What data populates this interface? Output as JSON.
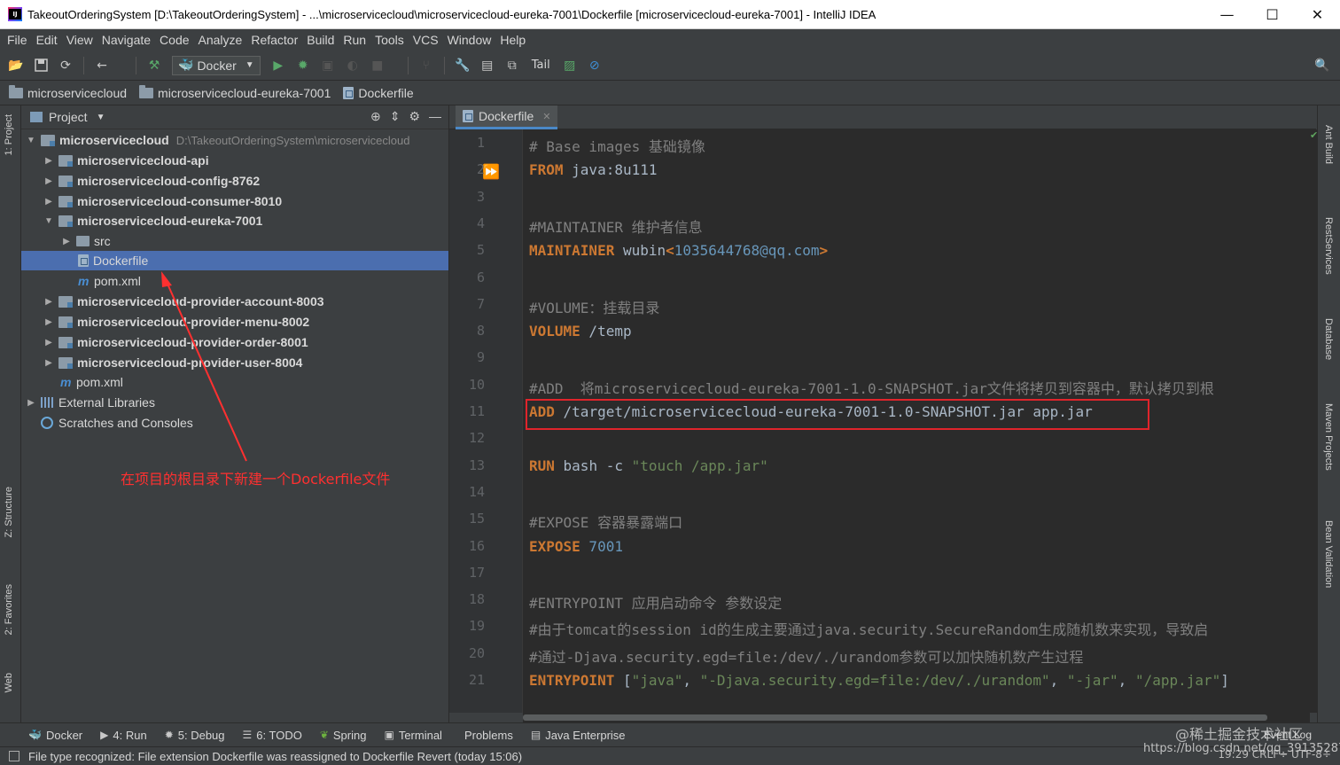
{
  "window": {
    "title": "TakeoutOrderingSystem [D:\\TakeoutOrderingSystem] - ...\\microservicecloud\\microservicecloud-eureka-7001\\Dockerfile [microservicecloud-eureka-7001] - IntelliJ IDEA",
    "minimize": "—",
    "maximize": "☐",
    "close": "✕"
  },
  "menu": [
    "File",
    "Edit",
    "View",
    "Navigate",
    "Code",
    "Analyze",
    "Refactor",
    "Build",
    "Run",
    "Tools",
    "VCS",
    "Window",
    "Help"
  ],
  "toolbar": {
    "run_config": "Docker",
    "tail": "Tail"
  },
  "breadcrumb": [
    "microservicecloud",
    "microservicecloud-eureka-7001",
    "Dockerfile"
  ],
  "left_tabs": {
    "project": "1: Project",
    "structure": "Z: Structure",
    "favorites": "2: Favorites",
    "web": "Web"
  },
  "project": {
    "header": "Project",
    "tree": [
      {
        "label": "microservicecloud",
        "hint": "D:\\TakeoutOrderingSystem\\microservicecloud"
      },
      {
        "label": "microservicecloud-api"
      },
      {
        "label": "microservicecloud-config-8762"
      },
      {
        "label": "microservicecloud-consumer-8010"
      },
      {
        "label": "microservicecloud-eureka-7001"
      },
      {
        "label": "src"
      },
      {
        "label": "Dockerfile"
      },
      {
        "label": "pom.xml"
      },
      {
        "label": "microservicecloud-provider-account-8003"
      },
      {
        "label": "microservicecloud-provider-menu-8002"
      },
      {
        "label": "microservicecloud-provider-order-8001"
      },
      {
        "label": "microservicecloud-provider-user-8004"
      },
      {
        "label": "pom.xml"
      },
      {
        "label": "External Libraries"
      },
      {
        "label": "Scratches and Consoles"
      }
    ]
  },
  "editor": {
    "tab": "Dockerfile",
    "lines": [
      {
        "n": "1",
        "parts": [
          [
            "cmt",
            "# Base images 基础镜像"
          ]
        ]
      },
      {
        "n": "2",
        "parts": [
          [
            "kw",
            "FROM"
          ],
          [
            "txt",
            " java:8u111"
          ]
        ]
      },
      {
        "n": "3",
        "parts": []
      },
      {
        "n": "4",
        "parts": [
          [
            "cmt",
            "#MAINTAINER 维护者信息"
          ]
        ]
      },
      {
        "n": "5",
        "parts": [
          [
            "kw",
            "MAINTAINER"
          ],
          [
            "txt",
            " wubin"
          ],
          [
            "kw",
            "<"
          ],
          [
            "lnk",
            "1035644768@qq.com"
          ],
          [
            "kw",
            ">"
          ]
        ]
      },
      {
        "n": "6",
        "parts": []
      },
      {
        "n": "7",
        "parts": [
          [
            "cmt",
            "#VOLUME：挂载目录"
          ]
        ]
      },
      {
        "n": "8",
        "parts": [
          [
            "kw",
            "VOLUME"
          ],
          [
            "txt",
            " /temp"
          ]
        ]
      },
      {
        "n": "9",
        "parts": []
      },
      {
        "n": "10",
        "parts": [
          [
            "cmt",
            "#ADD  将microservicecloud-eureka-7001-1.0-SNAPSHOT.jar文件将拷贝到容器中，默认拷贝到根"
          ]
        ]
      },
      {
        "n": "11",
        "parts": [
          [
            "kw",
            "ADD"
          ],
          [
            "txt",
            " /target/microservicecloud-eureka-7001-1.0-SNAPSHOT.jar app.jar"
          ]
        ]
      },
      {
        "n": "12",
        "parts": []
      },
      {
        "n": "13",
        "parts": [
          [
            "kw",
            "RUN"
          ],
          [
            "txt",
            " bash -c "
          ],
          [
            "str",
            "\"touch /app.jar\""
          ]
        ]
      },
      {
        "n": "14",
        "parts": []
      },
      {
        "n": "15",
        "parts": [
          [
            "cmt",
            "#EXPOSE 容器暴露端口"
          ]
        ]
      },
      {
        "n": "16",
        "parts": [
          [
            "kw",
            "EXPOSE"
          ],
          [
            "lnk",
            " 7001"
          ]
        ]
      },
      {
        "n": "17",
        "parts": []
      },
      {
        "n": "18",
        "parts": [
          [
            "cmt",
            "#ENTRYPOINT 应用启动命令 参数设定"
          ]
        ]
      },
      {
        "n": "19",
        "parts": [
          [
            "cmt",
            "#由于tomcat的session id的生成主要通过java.security.SecureRandom生成随机数来实现，导致启"
          ]
        ]
      },
      {
        "n": "20",
        "parts": [
          [
            "cmt",
            "#通过-Djava.security.egd=file:/dev/./urandom参数可以加快随机数产生过程"
          ]
        ]
      },
      {
        "n": "21",
        "parts": [
          [
            "kw",
            "ENTRYPOINT"
          ],
          [
            "txt",
            " ["
          ],
          [
            "str",
            "\"java\""
          ],
          [
            "txt",
            ", "
          ],
          [
            "str",
            "\"-Djava.security.egd=file:/dev/./urandom\""
          ],
          [
            "txt",
            ", "
          ],
          [
            "str",
            "\"-jar\""
          ],
          [
            "txt",
            ", "
          ],
          [
            "str",
            "\"/app.jar\""
          ],
          [
            "txt",
            "]"
          ]
        ]
      }
    ]
  },
  "right_tabs": [
    "Ant Build",
    "RestServices",
    "Database",
    "Maven Projects",
    "Bean Validation"
  ],
  "bottom_tabs": [
    {
      "icon": "docker-icon",
      "label": "Docker"
    },
    {
      "icon": "run-icon",
      "label": "4: Run"
    },
    {
      "icon": "debug-icon",
      "label": "5: Debug"
    },
    {
      "icon": "todo-icon",
      "label": "6: TODO"
    },
    {
      "icon": "spring-icon",
      "label": "Spring"
    },
    {
      "icon": "terminal-icon",
      "label": "Terminal"
    },
    {
      "icon": "problems-icon",
      "label": "Problems"
    },
    {
      "icon": "java-enterprise-icon",
      "label": "Java Enterprise"
    }
  ],
  "status": {
    "message": "File type recognized: File extension Dockerfile was reassigned to Dockerfile Revert (today 15:06)",
    "right": "19:29  CRLF÷  UTF-8÷"
  },
  "watermark": {
    "line1": "@稀土掘金技术社区",
    "line2": "https://blog.csdn.net/qq_39135287"
  },
  "event_log": "Event Log",
  "annotation": "在项目的根目录下新建一个Dockerfile文件"
}
